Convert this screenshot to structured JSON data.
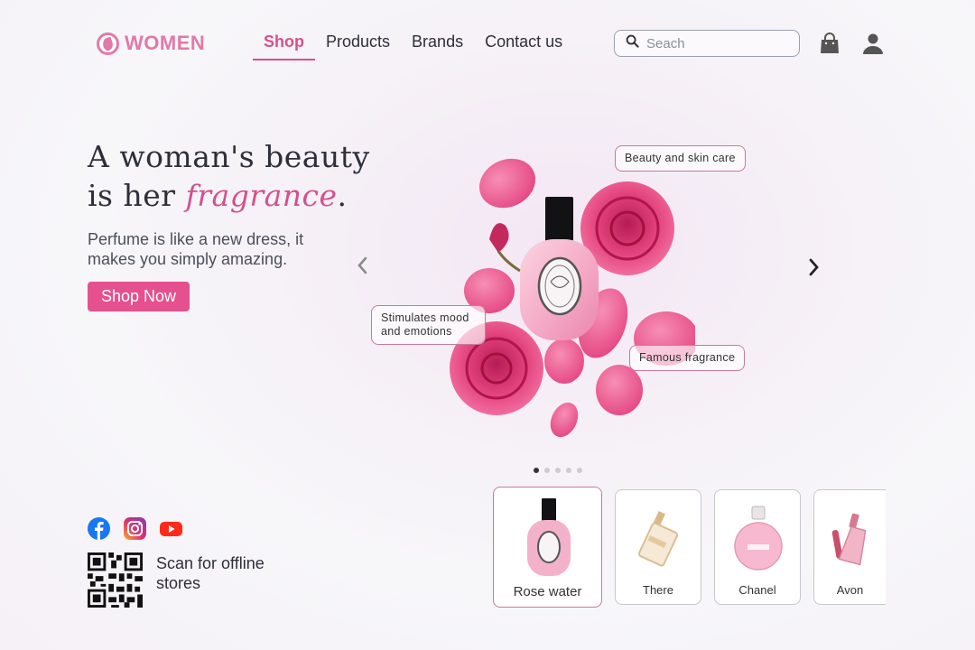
{
  "brand": {
    "name": "WOMEN",
    "color": "#e07aa9"
  },
  "nav": {
    "items": [
      {
        "label": "Shop",
        "active": true
      },
      {
        "label": "Products",
        "active": false
      },
      {
        "label": "Brands",
        "active": false
      },
      {
        "label": "Contact us",
        "active": false
      }
    ]
  },
  "search": {
    "placeholder": "Seach",
    "icon": "search-icon"
  },
  "header_icons": [
    "shopping-bag-icon",
    "user-icon"
  ],
  "hero": {
    "headline_line1": "A woman's beauty",
    "headline_line2_prefix": "is her ",
    "headline_accent": "fragrance",
    "headline_suffix": ".",
    "subtext": "Perfume is like a new dress, it makes you simply amazing.",
    "cta": "Shop Now",
    "accent_color": "#e5508f"
  },
  "carousel": {
    "tags": {
      "beauty": "Beauty and skin care",
      "mood": "Stimulates mood and emotions",
      "famous": "Famous fragrance"
    },
    "dots_count": 5,
    "active_dot": 1
  },
  "products": [
    {
      "label": "Rose water",
      "selected": true
    },
    {
      "label": "There",
      "selected": false
    },
    {
      "label": "Chanel",
      "selected": false
    },
    {
      "label": "Avon",
      "selected": false
    }
  ],
  "social": [
    "facebook-icon",
    "instagram-icon",
    "youtube-icon"
  ],
  "qr": {
    "text": "Scan for offline stores"
  }
}
